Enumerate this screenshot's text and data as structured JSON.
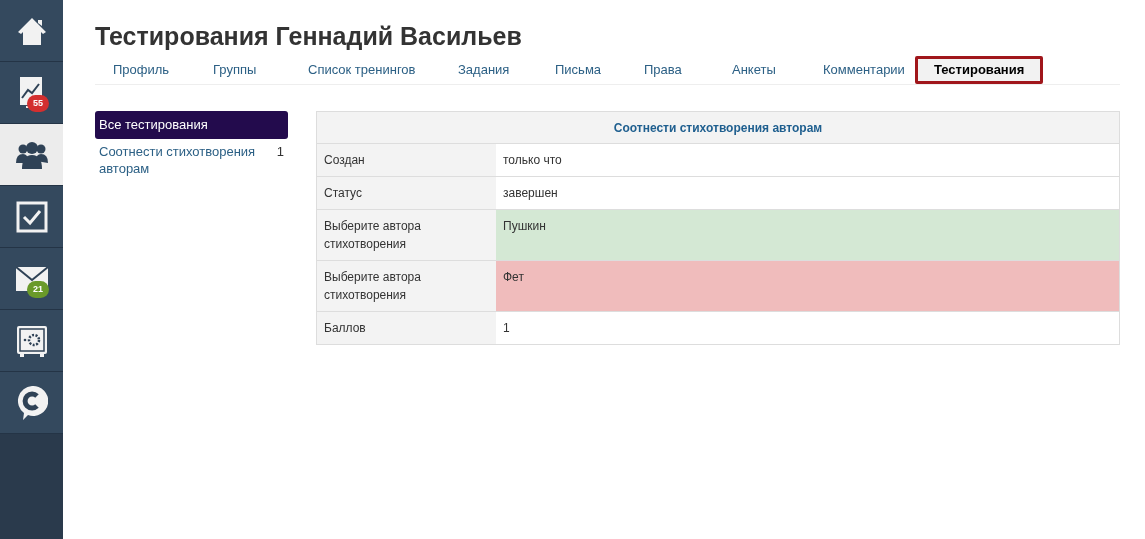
{
  "sidebar": {
    "items": [
      {
        "kind": "home",
        "selected": false
      },
      {
        "kind": "chart",
        "selected": false,
        "badge": {
          "text": "55",
          "color": "#d32f2f"
        }
      },
      {
        "kind": "people",
        "selected": true
      },
      {
        "kind": "check",
        "selected": false
      },
      {
        "kind": "mail",
        "selected": false,
        "badge": {
          "text": "21",
          "color": "#6a9a2a"
        }
      },
      {
        "kind": "safe",
        "selected": false
      },
      {
        "kind": "chat",
        "selected": false
      }
    ]
  },
  "title": "Тестирования Геннадий Васильев",
  "tabs": [
    {
      "label": "Профиль",
      "selected": false
    },
    {
      "label": "Группы",
      "selected": false
    },
    {
      "label": "Список тренингов",
      "selected": false
    },
    {
      "label": "Задания",
      "selected": false
    },
    {
      "label": "Письма",
      "selected": false
    },
    {
      "label": "Права",
      "selected": false
    },
    {
      "label": "Анкеты",
      "selected": false
    },
    {
      "label": "Комментарии",
      "selected": false
    },
    {
      "label": "Тестирования",
      "selected": true
    }
  ],
  "test_list": [
    {
      "label": "Все тестирования",
      "selected": true
    },
    {
      "label": "Соотнести стихотворения авторам",
      "count": "1",
      "selected": false
    }
  ],
  "result": {
    "title": "Соотнести стихотворения авторам",
    "rows": [
      {
        "label": "Создан",
        "value": "только что",
        "kind": "plain"
      },
      {
        "label": "Статус",
        "value": "завершен",
        "kind": "plain"
      },
      {
        "label": "Выберите автора стихотворения",
        "value": "Пушкин",
        "kind": "correct"
      },
      {
        "label": "Выберите автора стихотворения",
        "value": "Фет",
        "kind": "wrong"
      },
      {
        "label": "Баллов",
        "value": "1",
        "kind": "plain"
      }
    ]
  }
}
